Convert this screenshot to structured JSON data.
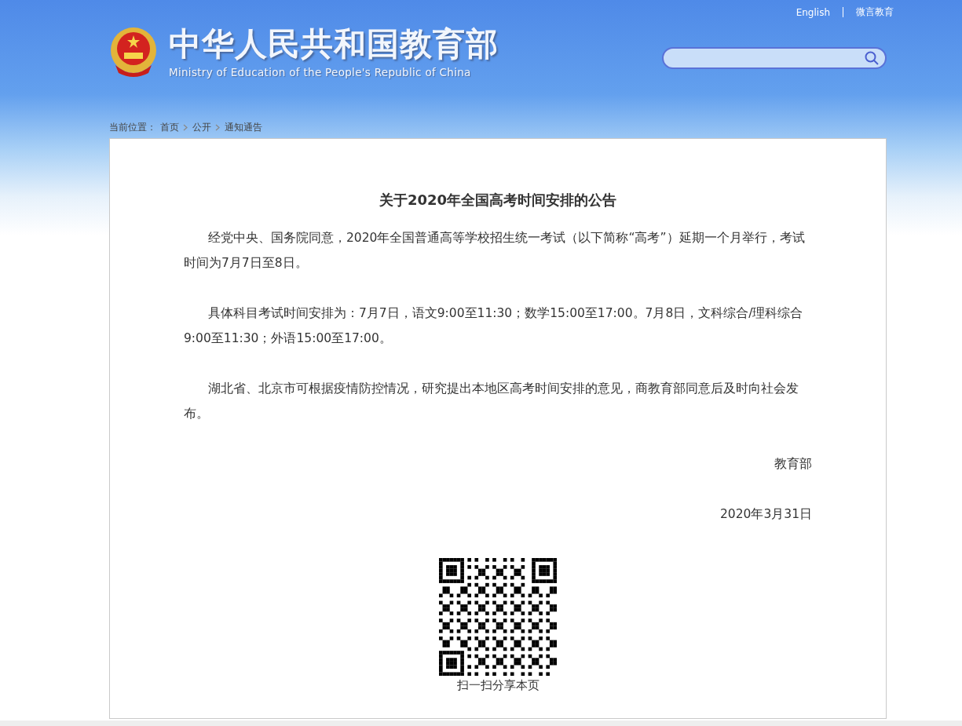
{
  "header": {
    "title": "中华人民共和国教育部",
    "subtitle": "Ministry of Education of the People's Republic of China",
    "links": [
      "English",
      "微言教育"
    ]
  },
  "breadcrumb": {
    "label": "当前位置：",
    "items": [
      "首页",
      "公开",
      "通知通告"
    ]
  },
  "article": {
    "title": "关于2020年全国高考时间安排的公告",
    "paragraphs": [
      "经党中央、国务院同意，2020年全国普通高等学校招生统一考试（以下简称“高考”）延期一个月举行，考试时间为7月7日至8日。",
      "具体科目考试时间安排为：7月7日，语文9:00至11:30；数学15:00至17:00。7月8日，文科综合/理科综合9:00至11:30；外语15:00至17:00。",
      "湖北省、北京市可根据疫情防控情况，研究提出本地区高考时间安排的意见，商教育部同意后及时向社会发布。"
    ],
    "signature": "教育部",
    "date": "2020年3月31日"
  },
  "share": {
    "caption": "扫一扫分享本页"
  }
}
